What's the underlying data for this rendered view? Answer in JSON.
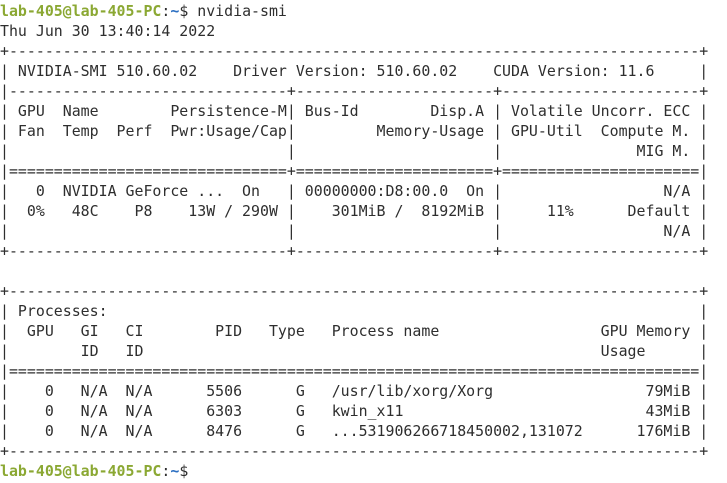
{
  "colors": {
    "background": "#ffffff",
    "foreground": "#2e2e2e",
    "prompt_user": "#8ba833",
    "prompt_path": "#2b6fc2"
  },
  "prompt": {
    "user_host": "lab-405@lab-405-PC",
    "colon": ":",
    "path": "~",
    "symbol": "$"
  },
  "command": "nvidia-smi",
  "output_lines": [
    "Thu Jun 30 13:40:14 2022",
    "+-----------------------------------------------------------------------------+",
    "| NVIDIA-SMI 510.60.02    Driver Version: 510.60.02    CUDA Version: 11.6     |",
    "|-------------------------------+----------------------+----------------------+",
    "| GPU  Name        Persistence-M| Bus-Id        Disp.A | Volatile Uncorr. ECC |",
    "| Fan  Temp  Perf  Pwr:Usage/Cap|         Memory-Usage | GPU-Util  Compute M. |",
    "|                               |                      |               MIG M. |",
    "|===============================+======================+======================|",
    "|   0  NVIDIA GeForce ...  On   | 00000000:D8:00.0  On |                  N/A |",
    "|  0%   48C    P8    13W / 290W |    301MiB /  8192MiB |     11%      Default |",
    "|                               |                      |                  N/A |",
    "+-------------------------------+----------------------+----------------------+",
    "",
    "+-----------------------------------------------------------------------------+",
    "| Processes:                                                                  |",
    "|  GPU   GI   CI        PID   Type   Process name                  GPU Memory |",
    "|        ID   ID                                                   Usage      |",
    "|=============================================================================|",
    "|    0   N/A  N/A      5506      G   /usr/lib/xorg/Xorg                 79MiB |",
    "|    0   N/A  N/A      6303      G   kwin_x11                           43MiB |",
    "|    0   N/A  N/A      8476      G   ...531906266718450002,131072      176MiB |",
    "+-----------------------------------------------------------------------------+"
  ]
}
